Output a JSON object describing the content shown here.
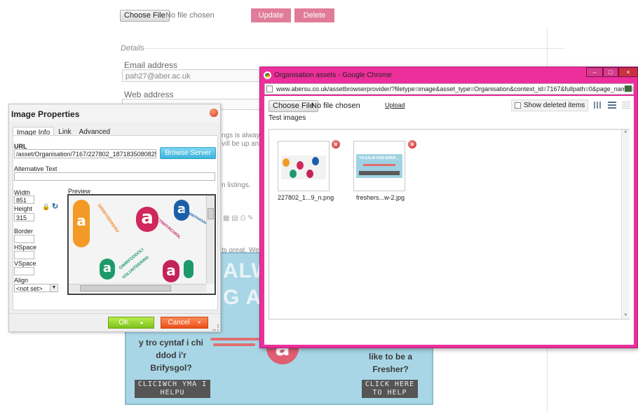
{
  "background_page": {
    "choose_file_label": "Choose File",
    "no_file_text": "No file chosen",
    "update_label": "Update",
    "delete_label": "Delete",
    "details_heading": "Details",
    "email_label": "Email address",
    "email_value": "pah27@aber.ac.uk",
    "web_label": "Web address",
    "snippet_1": "ngs is alway",
    "snippet_2": "vill be up an",
    "snippet_3": "n listings.",
    "snippet_4": "ts great. We h",
    "banner": {
      "big_1": "ALW Y",
      "big_2": "G A",
      "left_text": "y tro cyntaf i chi ddod i'r Brifysgol?",
      "right_text": "like to be a Fresher?",
      "left_button": "CLICIWCH YMA I HELPU",
      "right_button": "CLICK HERE TO HELP"
    }
  },
  "image_dialog": {
    "title": "Image Properties",
    "tabs": [
      "Image Info",
      "Link",
      "Advanced"
    ],
    "url_label": "URL",
    "url_value": "/asset/Organisation/7167/227802_18718350808259",
    "browse_label": "Browse Server",
    "alt_label": "Alternative Text",
    "alt_value": "",
    "width_label": "Width",
    "width_value": "851",
    "height_label": "Height",
    "height_value": "315",
    "border_label": "Border",
    "hspace_label": "HSpace",
    "vspace_label": "VSpace",
    "align_label": "Align",
    "align_value": "<not set>",
    "preview_label": "Preview",
    "ok_label": "OK",
    "cancel_label": "Cancel",
    "preview_letter": "a",
    "preview_words": {
      "w1": "CYNHYRCHIOL",
      "w2": "DIGWYDDIADAU",
      "w3": "GWIRFODDOLI",
      "w4": "VOLUNTEERING",
      "w5": "CYMDEITHASAU"
    }
  },
  "chrome_window": {
    "title": "Organisation assets - Google Chrome",
    "url": "www.abersu.co.uk/assetbrowserprovider/?filetype=image&asset_type=Organisation&context_id=7167&fullpath=0&page_name=&CKEdit",
    "choose_file_label": "Choose File",
    "no_file_text": "No file chosen",
    "upload_label": "Upload",
    "show_deleted_label": "Show deleted items",
    "section_label": "Test images",
    "images": [
      {
        "name": "227802_1...9_n.png"
      },
      {
        "name": "freshers...w-2.jpg"
      }
    ],
    "thumb2_text": "YN GALW POB ARWR..."
  },
  "colors": {
    "chrome_frame": "#ec2f9a",
    "ok_green": "#7cc21c",
    "cancel_orange": "#e9501a",
    "browse_blue": "#3cb3dc",
    "pink_button": "#e07c9a"
  }
}
